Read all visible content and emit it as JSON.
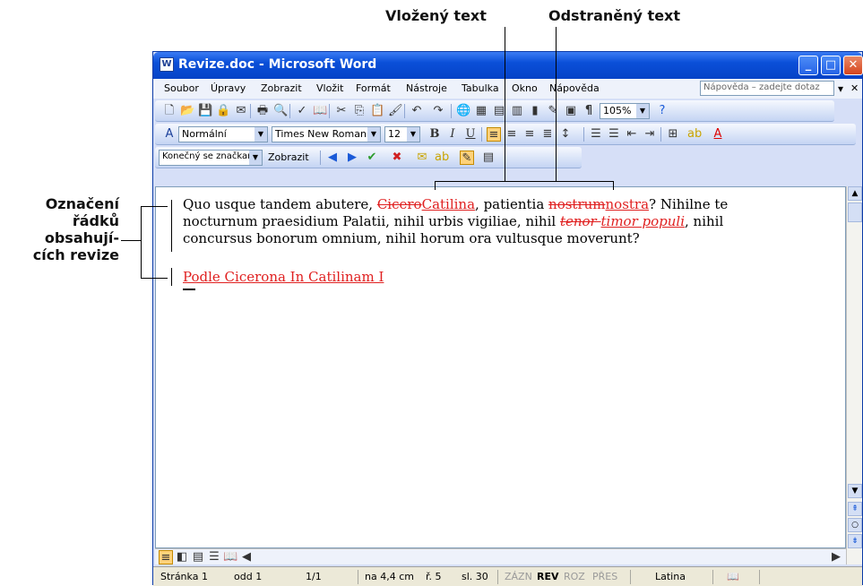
{
  "callouts": {
    "inserted": "Vložený text",
    "deleted": "Odstraněný text",
    "revision_lines": [
      "Označení",
      "řádků",
      "obsahují-",
      "cích revize"
    ]
  },
  "window": {
    "title": "Revize.doc - Microsoft Word",
    "menu": [
      "Soubor",
      "Úpravy",
      "Zobrazit",
      "Vložit",
      "Formát",
      "Nástroje",
      "Tabulka",
      "Okno",
      "Nápověda"
    ],
    "help_placeholder": "Nápověda – zadejte dotaz"
  },
  "toolbar_standard": {
    "zoom": "105%"
  },
  "toolbar_format": {
    "style": "Normální",
    "font": "Times New Roman",
    "size": "12"
  },
  "toolbar_review": {
    "display_mode": "Konečný se značkami",
    "show_label": "Zobrazit"
  },
  "document": {
    "para1_line1": {
      "a": "Quo usque tandem abutere, ",
      "del1": "Cicero",
      "ins1": "Catilina",
      "b": ", patientia ",
      "del2": "nostrum",
      "ins2": "nostra",
      "c": "? Nihilne te"
    },
    "para1_line2": {
      "a": "nocturnum praesidium Palatii, nihil urbis vigiliae, nihil ",
      "del3": "tenor ",
      "ins3": "timor populi",
      "b": ", nihil"
    },
    "para1_line3": "concursus bonorum omnium, nihil horum ora vultusque moverunt?",
    "para2": "Podle Cicerona In Catilinam I"
  },
  "status": {
    "page": "Stránka 1",
    "section": "odd 1",
    "pages": "1/1",
    "at": "na 4,4 cm",
    "line": "ř. 5",
    "col": "sl. 30",
    "rec": "ZÁZN",
    "rev": "REV",
    "ext": "ROZ",
    "ovr": "PŘES",
    "language": "Latina"
  }
}
